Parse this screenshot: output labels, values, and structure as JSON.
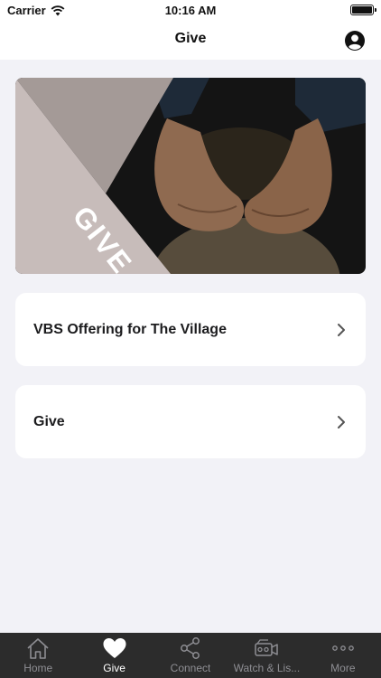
{
  "status_bar": {
    "carrier": "Carrier",
    "time": "10:16 AM"
  },
  "nav": {
    "title": "Give"
  },
  "banner": {
    "text": "GIVE",
    "colors": {
      "light_panel": "#c7bcba",
      "mid_panel": "#a49a97",
      "dark_photo": "#141414"
    }
  },
  "items": [
    {
      "label": "VBS Offering for The Village"
    },
    {
      "label": "Give"
    }
  ],
  "tab_bar": {
    "tabs": [
      {
        "label": "Home",
        "icon": "home-icon"
      },
      {
        "label": "Give",
        "icon": "heart-icon",
        "active": true
      },
      {
        "label": "Connect",
        "icon": "share-icon"
      },
      {
        "label": "Watch & Lis...",
        "icon": "video-camera-icon"
      },
      {
        "label": "More",
        "icon": "more-icon"
      }
    ],
    "active_color": "#ffffff",
    "inactive_color": "#8e8e93"
  }
}
